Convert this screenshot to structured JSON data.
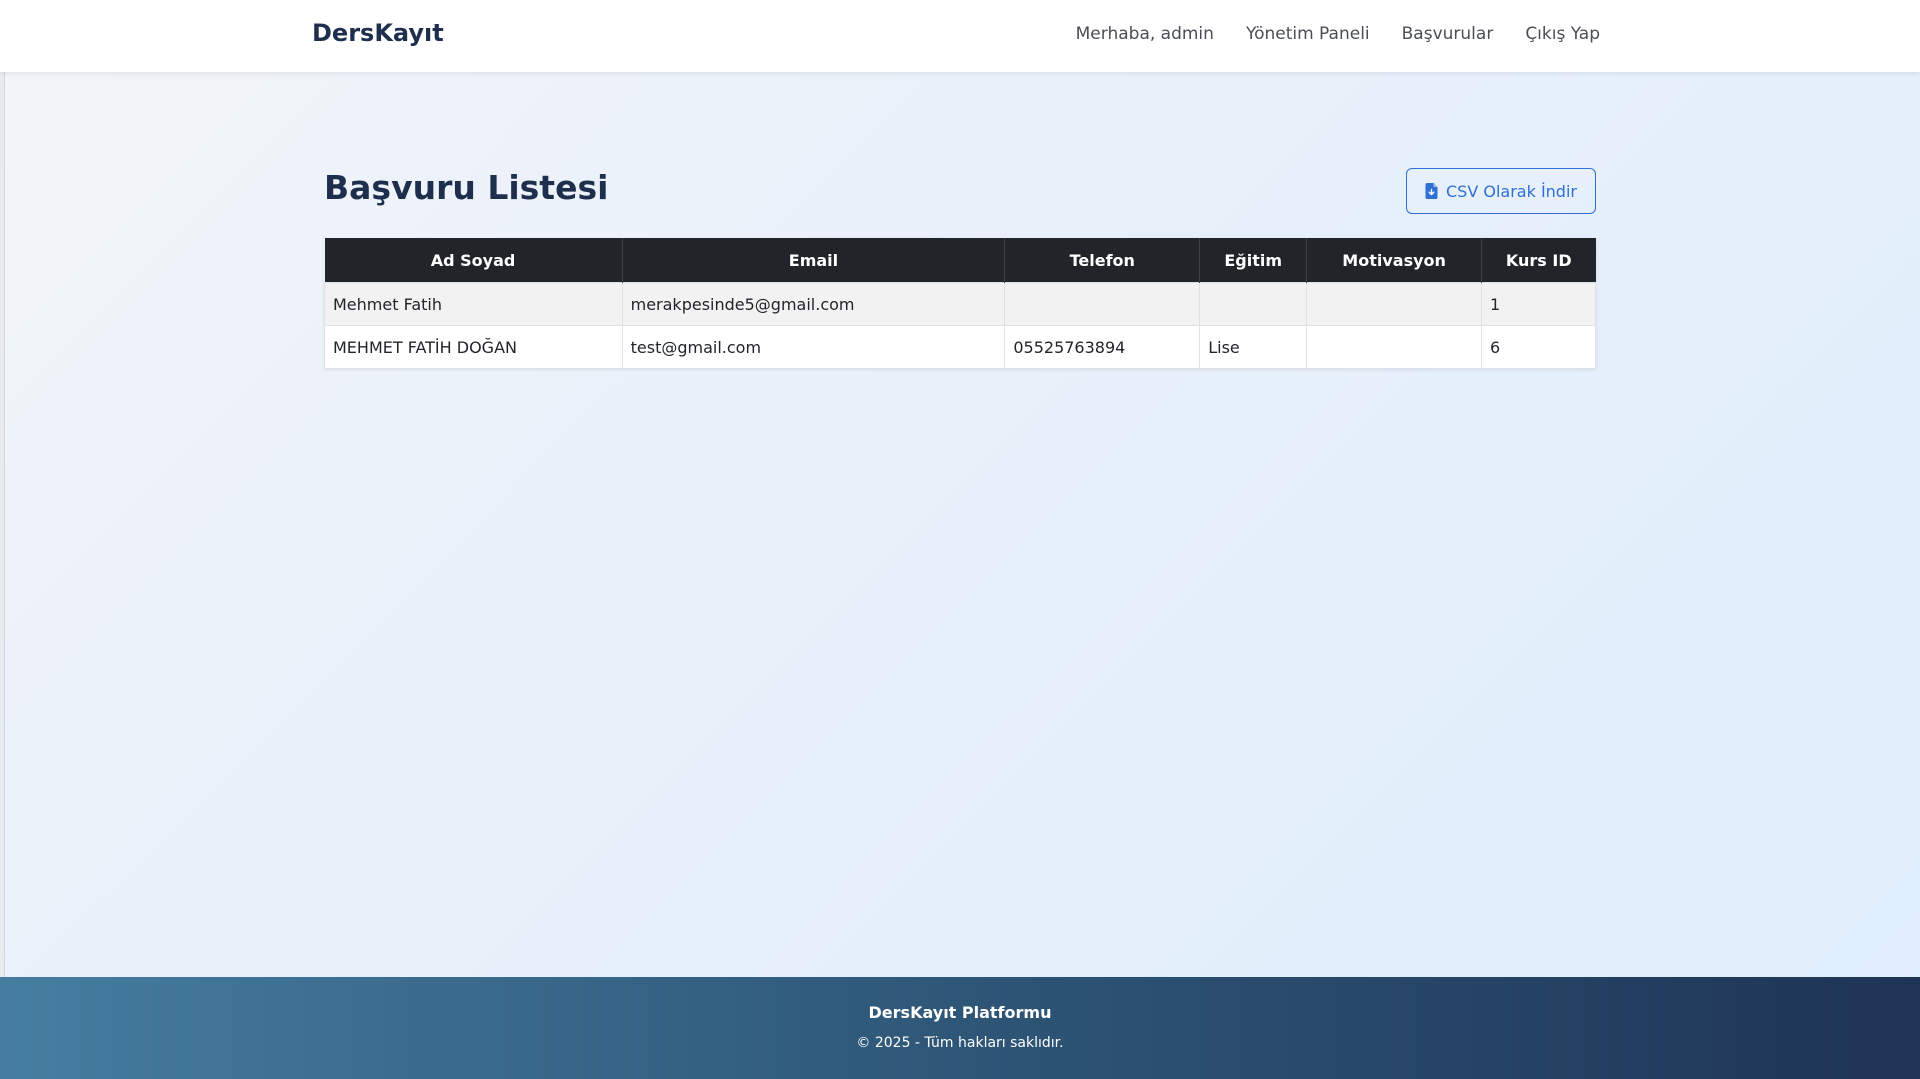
{
  "navbar": {
    "brand": "DersKayıt",
    "greeting": "Merhaba, admin",
    "links": [
      "Yönetim Paneli",
      "Başvurular",
      "Çıkış Yap"
    ]
  },
  "page": {
    "title": "Başvuru Listesi",
    "csv_button_label": "CSV Olarak İndir"
  },
  "table": {
    "headers": [
      "Ad Soyad",
      "Email",
      "Telefon",
      "Eğitim",
      "Motivasyon",
      "Kurs ID"
    ],
    "rows": [
      [
        "Mehmet Fatih",
        "merakpesinde5@gmail.com",
        "",
        "",
        "",
        "1"
      ],
      [
        "MEHMET FATİH DOĞAN",
        "test@gmail.com",
        "05525763894",
        "Lise",
        "",
        "6"
      ]
    ]
  },
  "footer": {
    "brand": "DersKayıt Platformu",
    "copyright": "© 2025 - Tüm hakları saklıdır."
  },
  "colors": {
    "brand": "#1e2f4d",
    "accent": "#2f6fd6",
    "table_header": "#212529"
  },
  "icons": {
    "csv_button": "file-download-icon"
  }
}
